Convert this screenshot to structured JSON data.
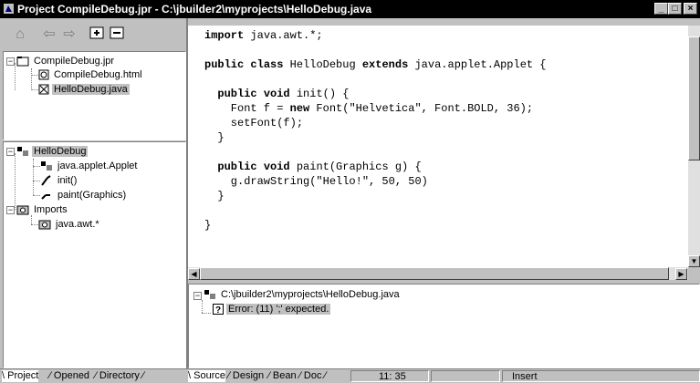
{
  "window": {
    "title": "Project CompileDebug.jpr - C:\\jbuilder2\\myprojects\\HelloDebug.java",
    "controls": [
      "_",
      "□",
      "×"
    ]
  },
  "toolbar": {
    "icons": [
      "home-icon",
      "back-icon",
      "forward-icon",
      "add-icon",
      "remove-icon"
    ]
  },
  "project_tree": {
    "root": "CompileDebug.jpr",
    "files": [
      "CompileDebug.html",
      "HelloDebug.java"
    ],
    "selected": "HelloDebug.java"
  },
  "structure_tree": {
    "class": "HelloDebug",
    "members": [
      "java.applet.Applet",
      "init()",
      "paint(Graphics)"
    ],
    "imports_label": "Imports",
    "imports": [
      "java.awt.*"
    ]
  },
  "editor": {
    "lines": [
      "import java.awt.*;",
      "",
      "public class HelloDebug extends java.applet.Applet {",
      "",
      "  public void init() {",
      "    Font f = new Font(\"Helvetica\", Font.BOLD, 36);",
      "    setFont(f);",
      "  }",
      "",
      "  public void paint(Graphics g) {",
      "    g.drawString(\"Hello!\", 50, 50)",
      "  }",
      "",
      "}"
    ]
  },
  "messages": {
    "file": "C:\\jbuilder2\\myprojects\\HelloDebug.java",
    "error": "Error: (11) ';' expected."
  },
  "left_tabs": [
    "Project",
    "Opened",
    "Directory"
  ],
  "editor_tabs": [
    "Source",
    "Design",
    "Bean",
    "Doc"
  ],
  "status": {
    "position": "11: 35",
    "mode": "Insert"
  }
}
